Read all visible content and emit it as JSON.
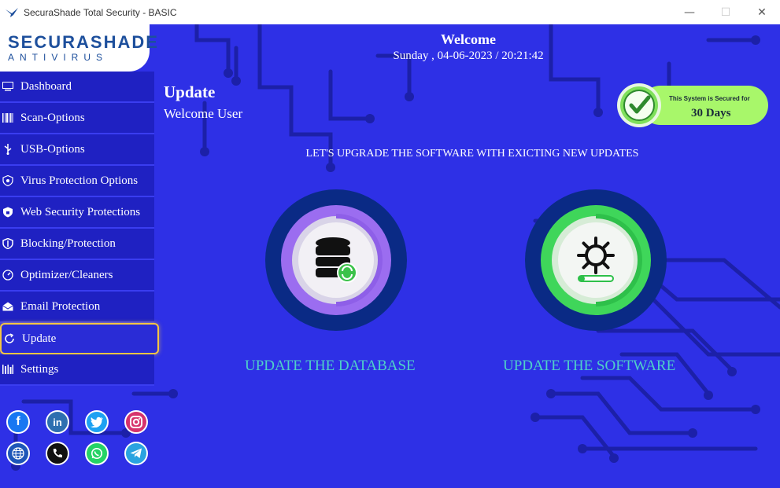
{
  "window": {
    "title": "SecuraShade Total Security - BASIC",
    "minimize_glyph": "—",
    "maximize_glyph": "☐",
    "close_glyph": "✕"
  },
  "logo": {
    "name": "SECURASHADE",
    "subtitle": "ANTIVIRUS"
  },
  "header": {
    "welcome": "Welcome",
    "datetime": "Sunday , 04-06-2023 / 20:21:42"
  },
  "sidebar": {
    "items": [
      {
        "label": "Dashboard",
        "icon": "monitor-icon"
      },
      {
        "label": "Scan-Options",
        "icon": "barcode-icon"
      },
      {
        "label": "USB-Options",
        "icon": "usb-icon"
      },
      {
        "label": "Virus Protection Options",
        "icon": "virus-shield-icon"
      },
      {
        "label": "Web Security Protections",
        "icon": "lock-shield-icon"
      },
      {
        "label": "Blocking/Protection",
        "icon": "shield-icon"
      },
      {
        "label": "Optimizer/Cleaners",
        "icon": "gauge-icon"
      },
      {
        "label": "Email Protection",
        "icon": "email-icon"
      },
      {
        "label": "Update",
        "icon": "refresh-icon",
        "active": true
      },
      {
        "label": "Settings",
        "icon": "settings-icon"
      }
    ]
  },
  "page": {
    "title": "Update",
    "subtitle": "Welcome User",
    "tagline": "LET'S UPGRADE THE SOFTWARE WITH EXICTING NEW UPDATES"
  },
  "badge": {
    "line1": "This System is Secured for",
    "line2": "30 Days"
  },
  "updates": {
    "database_label": "UPDATE THE DATABASE",
    "software_label": "UPDATE THE SOFTWARE"
  },
  "social": {
    "facebook": "f",
    "linkedin": "in"
  },
  "colors": {
    "background": "#2e30e6",
    "sidebar": "#1f21c2",
    "active_border": "#f4c542",
    "accent_text": "#4fd0c8",
    "badge_green": "#a8f76a"
  }
}
